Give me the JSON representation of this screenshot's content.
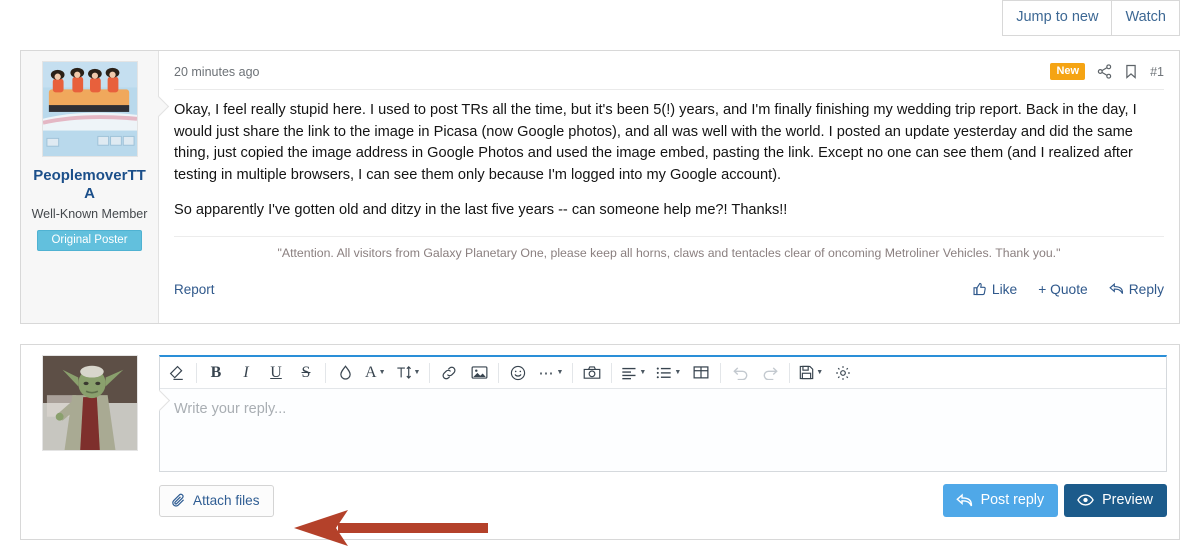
{
  "topbar": {
    "jump_to_new": "Jump to new",
    "watch": "Watch"
  },
  "post": {
    "date": "20 minutes ago",
    "new_badge": "New",
    "share_icon": "share-icon",
    "bookmark_icon": "bookmark-icon",
    "post_number": "#1",
    "author": {
      "username": "PeoplemoverTTA",
      "title": "Well-Known Member",
      "badge": "Original Poster",
      "avatar_icon": "peoplemover-avatar"
    },
    "paragraphs": [
      "Okay, I feel really stupid here. I used to post TRs all the time, but it's been 5(!) years, and I'm finally finishing my wedding trip report. Back in the day, I would just share the link to the image in Picasa (now Google photos), and all was well with the world. I posted an update yesterday and did the same thing, just copied the image address in Google Photos and used the image embed, pasting the link. Except no one can see them (and I realized after testing in multiple browsers, I can see them only because I'm logged into my Google account).",
      "So apparently I've gotten old and ditzy in the last five years -- can someone help me?! Thanks!!"
    ],
    "signature": "\"Attention. All visitors from Galaxy Planetary One, please keep all horns, claws and tentacles clear of oncoming Metroliner Vehicles. Thank you.\"",
    "footer": {
      "report": "Report",
      "like": "Like",
      "quote": "+ Quote",
      "reply": "Reply"
    }
  },
  "reply": {
    "avatar_icon": "yoda-avatar",
    "toolbar": [
      {
        "name": "remove-formatting-icon",
        "glyph": "◇",
        "label": "Remove formatting"
      },
      {
        "name": "bold-icon",
        "glyph": "B",
        "label": "Bold"
      },
      {
        "name": "italic-icon",
        "glyph": "I",
        "label": "Italic"
      },
      {
        "name": "underline-icon",
        "glyph": "U",
        "label": "Underline"
      },
      {
        "name": "strikethrough-icon",
        "glyph": "S",
        "label": "Strike through"
      },
      {
        "name": "text-color-icon",
        "glyph": "●",
        "label": "Text color"
      },
      {
        "name": "font-family-icon",
        "glyph": "A",
        "label": "Font"
      },
      {
        "name": "font-size-icon",
        "glyph": "T",
        "label": "Font size"
      },
      {
        "name": "link-icon",
        "glyph": "🔗",
        "label": "Insert link"
      },
      {
        "name": "image-icon",
        "glyph": "▣",
        "label": "Insert image"
      },
      {
        "name": "smilies-icon",
        "glyph": "☺",
        "label": "Smilies"
      },
      {
        "name": "more-options-icon",
        "glyph": "⋯",
        "label": "More options"
      },
      {
        "name": "media-icon",
        "glyph": "◎",
        "label": "Insert media"
      },
      {
        "name": "text-align-icon",
        "glyph": "≡",
        "label": "Alignment"
      },
      {
        "name": "list-icon",
        "glyph": "☰",
        "label": "List"
      },
      {
        "name": "table-icon",
        "glyph": "⊞",
        "label": "Insert table"
      },
      {
        "name": "undo-icon",
        "glyph": "↺",
        "label": "Undo"
      },
      {
        "name": "redo-icon",
        "glyph": "↻",
        "label": "Redo"
      },
      {
        "name": "drafts-icon",
        "glyph": "💾",
        "label": "Drafts"
      },
      {
        "name": "settings-gear-icon",
        "glyph": "⚙",
        "label": "Settings"
      }
    ],
    "placeholder": "Write your reply...",
    "attach_files": "Attach files",
    "post_reply": "Post reply",
    "preview": "Preview"
  },
  "annotation": {
    "arrow_color": "#b4412a"
  },
  "colors": {
    "link": "#30598c",
    "badge_new": "#f5a413",
    "badge_op": "#62c0dd",
    "primary_button": "#4fa8e8",
    "dark_button": "#1c5b8b",
    "editor_accent": "#2a8fd8"
  }
}
